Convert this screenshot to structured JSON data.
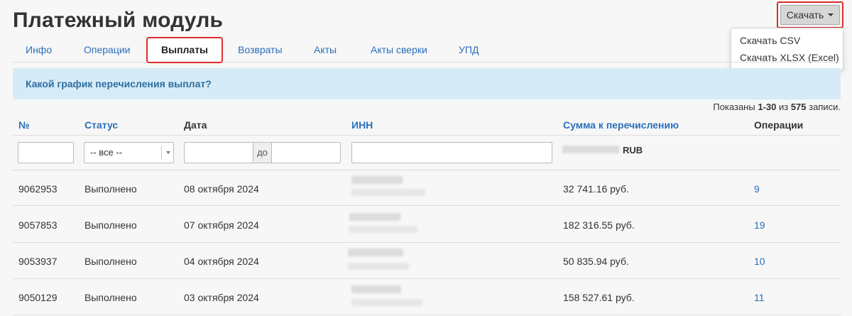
{
  "page": {
    "title": "Платежный модуль"
  },
  "download": {
    "button_label": "Скачать",
    "menu": [
      "Скачать CSV",
      "Скачать XLSX (Excel)"
    ]
  },
  "tabs": [
    "Инфо",
    "Операции",
    "Выплаты",
    "Возвраты",
    "Акты",
    "Акты сверки",
    "УПД"
  ],
  "active_tab": "Выплаты",
  "banner": {
    "text": "Какой график перечисления выплат?"
  },
  "records": {
    "prefix": "Показаны ",
    "range": "1-30",
    "middle": " из ",
    "total": "575",
    "suffix": " записи."
  },
  "table": {
    "headers": {
      "num": "№",
      "status": "Статус",
      "date": "Дата",
      "inn": "ИНН",
      "amount": "Сумма к перечислению",
      "ops": "Операции"
    },
    "filters": {
      "status_value": "-- все --",
      "date_to": "до",
      "currency": "RUB"
    },
    "rows": [
      {
        "num": "9062953",
        "status": "Выполнено",
        "date": "08 октября 2024",
        "amount": "32 741.16 руб.",
        "ops": "9"
      },
      {
        "num": "9057853",
        "status": "Выполнено",
        "date": "07 октября 2024",
        "amount": "182 316.55 руб.",
        "ops": "19"
      },
      {
        "num": "9053937",
        "status": "Выполнено",
        "date": "04 октября 2024",
        "amount": "50 835.94 руб.",
        "ops": "10"
      },
      {
        "num": "9050129",
        "status": "Выполнено",
        "date": "03 октября 2024",
        "amount": "158 527.61 руб.",
        "ops": "11"
      }
    ]
  },
  "colors": {
    "link": "#2a6ebb",
    "highlight_border": "#d9302c",
    "banner_bg": "#d6ebf8"
  }
}
